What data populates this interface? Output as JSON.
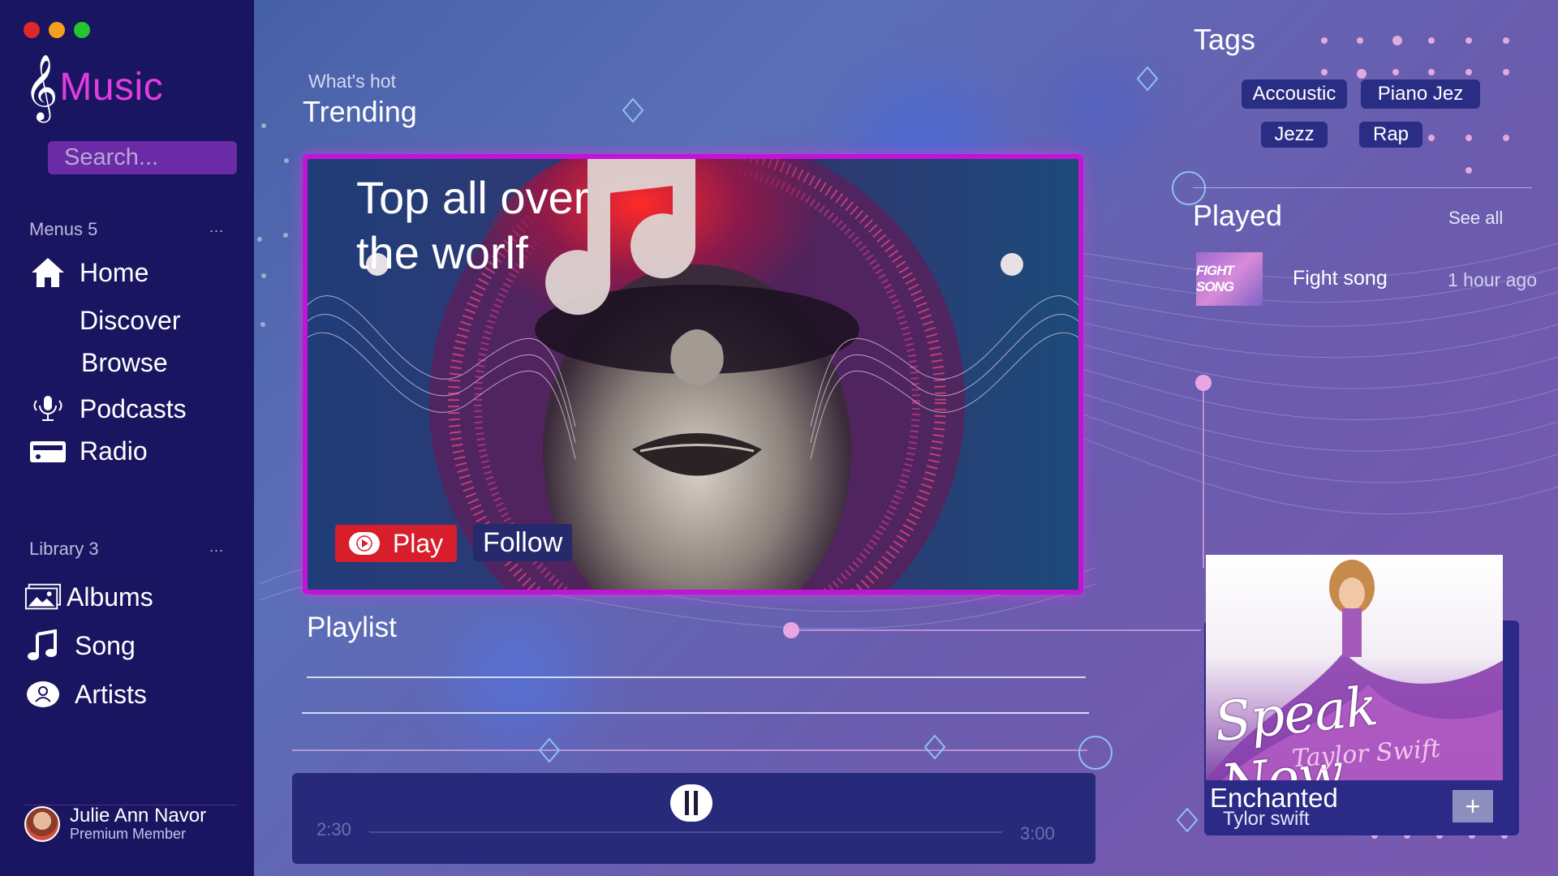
{
  "app": {
    "brand_icon": "treble-clef-icon",
    "brand_name": "Music"
  },
  "window_controls": {
    "close_color": "#e0282c",
    "minimize_color": "#f4a01f",
    "maximize_color": "#24c52f"
  },
  "search": {
    "placeholder": "Search..."
  },
  "menus": {
    "heading": "Menus 5",
    "more": "...",
    "items": [
      {
        "label": "Home",
        "icon": "home-icon"
      },
      {
        "label": "Discover",
        "icon": ""
      },
      {
        "label": "Browse",
        "icon": ""
      },
      {
        "label": "Podcasts",
        "icon": "microphone-icon"
      },
      {
        "label": "Radio",
        "icon": "radio-icon"
      }
    ]
  },
  "library": {
    "heading": "Library 3",
    "more": "...",
    "items": [
      {
        "label": "Albums",
        "icon": "image-icon"
      },
      {
        "label": "Song",
        "icon": "music-note-icon"
      },
      {
        "label": "Artists",
        "icon": "user-icon"
      }
    ]
  },
  "user": {
    "name": "Julie Ann Navor",
    "role": "Premium Member"
  },
  "main": {
    "eyebrow": "What's hot",
    "trending_title": "Trending",
    "hero": {
      "headline": "Top all over the worlf",
      "play_label": "Play",
      "follow_label": "Follow"
    },
    "playlist_title": "Playlist"
  },
  "player": {
    "elapsed": "2:30",
    "duration": "3:00",
    "progress": 0.0
  },
  "tags": {
    "title": "Tags",
    "items": [
      "Accoustic",
      "Piano Jez",
      "Jezz",
      "Rap"
    ]
  },
  "played": {
    "title": "Played",
    "see_all": "See all",
    "items": [
      {
        "thumb_text": "FIGHT SONG",
        "title": "Fight song",
        "time": "1 hour ago"
      }
    ]
  },
  "now_playing": {
    "album_text": "Speak Now",
    "album_artist_text": "Taylor Swift",
    "title": "Enchanted",
    "artist": "Tylor swift",
    "add_label": "+"
  },
  "colors": {
    "sidebar": "#1a1560",
    "accent_pink": "#e33ce0",
    "play_red": "#d81e2b",
    "tag_bg": "#2a2d84"
  }
}
